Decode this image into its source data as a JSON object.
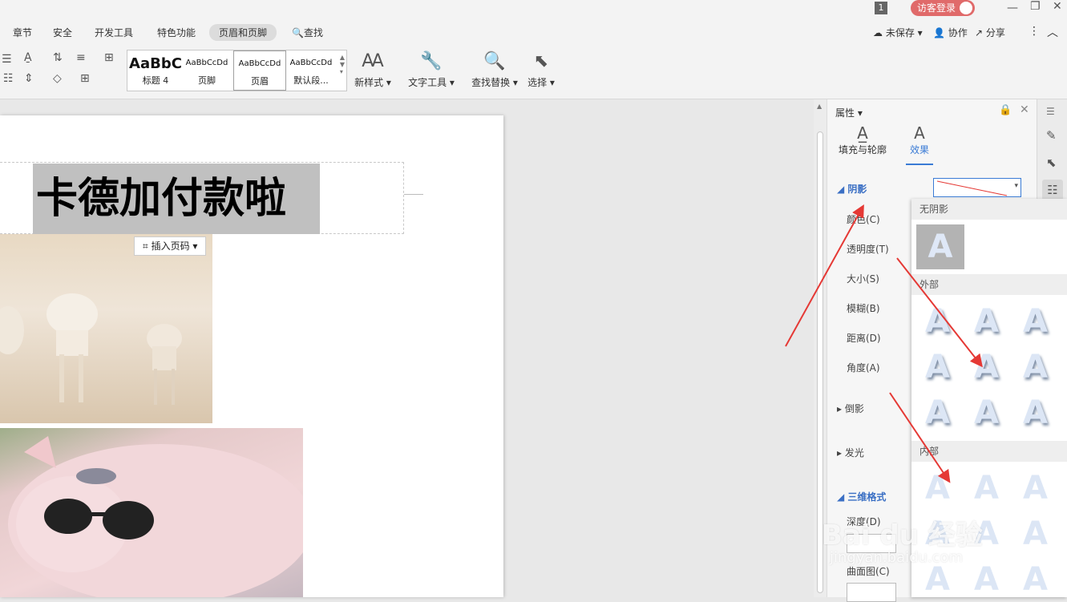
{
  "titlebar": {
    "badge": "1",
    "login_label": "访客登录"
  },
  "tabs": [
    {
      "label": "章节"
    },
    {
      "label": "安全"
    },
    {
      "label": "开发工具"
    },
    {
      "label": "特色功能"
    },
    {
      "label": "页眉和页脚"
    },
    {
      "label": "查找"
    }
  ],
  "right_actions": {
    "unsaved": "未保存",
    "collab": "协作",
    "share": "分享"
  },
  "styles": [
    {
      "sample": "AaBbC",
      "label": "标题 4"
    },
    {
      "sample": "AaBbCcDd",
      "label": "页脚"
    },
    {
      "sample": "AaBbCcDd",
      "label": "页眉"
    },
    {
      "sample": "AaBbCcDd",
      "label": "默认段..."
    }
  ],
  "tools": {
    "new_style": "新样式",
    "text_tools": "文字工具",
    "find_replace": "查找替换",
    "select": "选择"
  },
  "document": {
    "title": "卡德加付款啦",
    "insert_page_number": "插入页码"
  },
  "panel": {
    "title": "属性",
    "tab_fill": "填充与轮廓",
    "tab_effect": "效果",
    "section_shadow": "阴影",
    "color": "颜色(C)",
    "transparency": "透明度(T)",
    "size": "大小(S)",
    "blur": "模糊(B)",
    "distance": "距离(D)",
    "angle": "角度(A)",
    "reflection": "倒影",
    "glow": "发光",
    "threed": "三维格式",
    "depth": "深度(D)",
    "contour": "曲面图(C)"
  },
  "dropdown": {
    "no_shadow": "无阴影",
    "outer": "外部",
    "inner": "内部",
    "sample_letter": "A"
  },
  "watermark": {
    "text": "Bai du 经验",
    "url": "jingyan.baidu.com"
  }
}
